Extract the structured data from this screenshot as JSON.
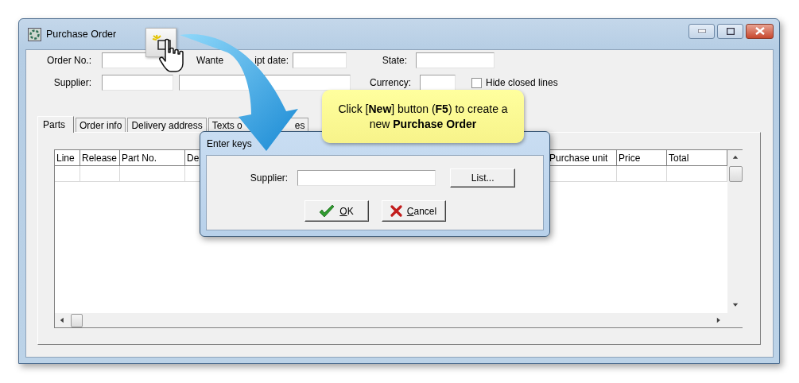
{
  "window": {
    "title": "Purchase Order"
  },
  "form": {
    "order_no_label": "Order No.:",
    "wanted_date_label_parts": [
      "Wante",
      "ipt date:"
    ],
    "state_label": "State:",
    "supplier_label": "Supplier:",
    "currency_label": "Currency:"
  },
  "hide_closed_lines": {
    "label": "Hide closed lines",
    "checked": false
  },
  "tabs": [
    {
      "label_parts": [
        "Parts"
      ],
      "selected": true
    },
    {
      "label_parts": [
        "Order info"
      ],
      "selected": false
    },
    {
      "label_parts": [
        "Delivery address"
      ],
      "selected": false
    },
    {
      "label_parts": [
        "Texts o",
        "es"
      ],
      "selected": false
    }
  ],
  "table": {
    "columns": [
      "Line",
      "Release",
      "Part No.",
      "De",
      "Purchase unit",
      "Price",
      "Total"
    ]
  },
  "dialog": {
    "title": "Enter keys",
    "supplier_label": "Supplier:",
    "list_button": "List...",
    "ok_button": "OK",
    "cancel_button": "Cancel"
  },
  "callout": {
    "text": "Click [**New**] button (**F5**) to create a new **Purchase Order**"
  }
}
